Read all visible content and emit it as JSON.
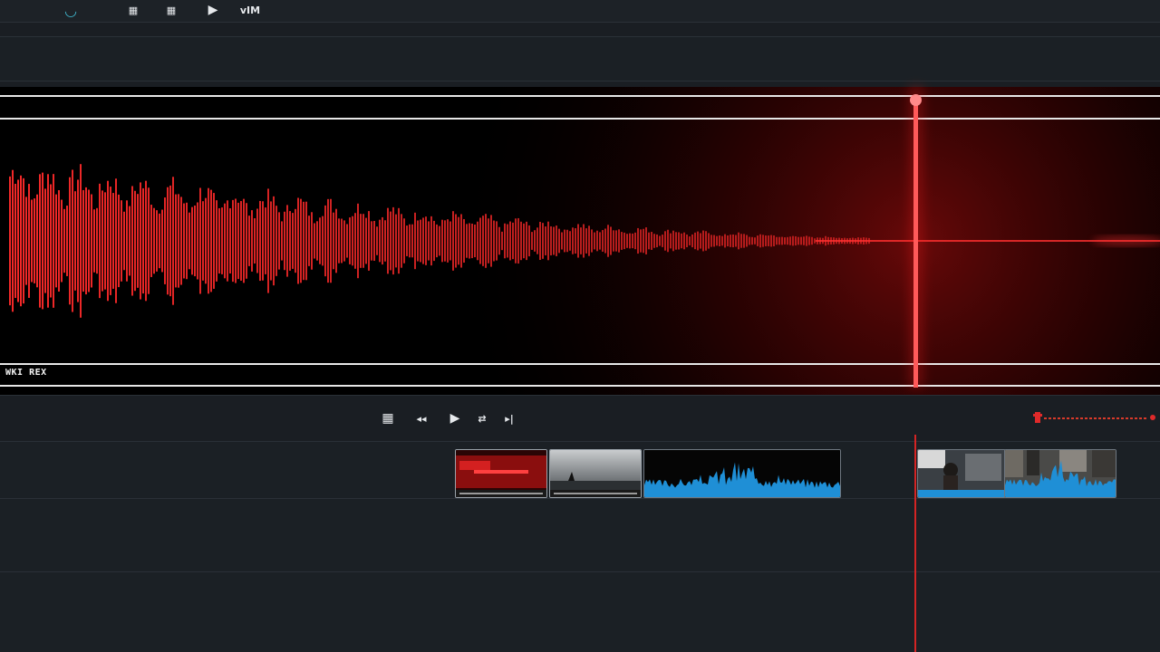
{
  "toolbar": {
    "buttons": [
      {
        "name": "loop-icon",
        "glyph": "◡"
      },
      {
        "name": "grid-tool-1",
        "glyph": "▦"
      },
      {
        "name": "grid-tool-2",
        "glyph": "▦"
      },
      {
        "name": "play-icon",
        "glyph": "▶"
      },
      {
        "name": "mixer-label",
        "label": "vIM"
      }
    ]
  },
  "viewer": {
    "track_label": "WKI REX"
  },
  "transport": {
    "buttons": [
      {
        "name": "grid-icon",
        "glyph": "▦"
      },
      {
        "name": "rewind-icon",
        "glyph": "◂◂"
      },
      {
        "name": "play-icon",
        "glyph": "▶"
      },
      {
        "name": "loop-icon",
        "glyph": "⇄"
      },
      {
        "name": "skip-end-icon",
        "glyph": "▸|"
      }
    ]
  },
  "colors": {
    "waveform": "#ff2a2a",
    "playhead": "#ff3b3b",
    "audio_clip": "#1f8fd6",
    "background": "#1a1e23"
  }
}
